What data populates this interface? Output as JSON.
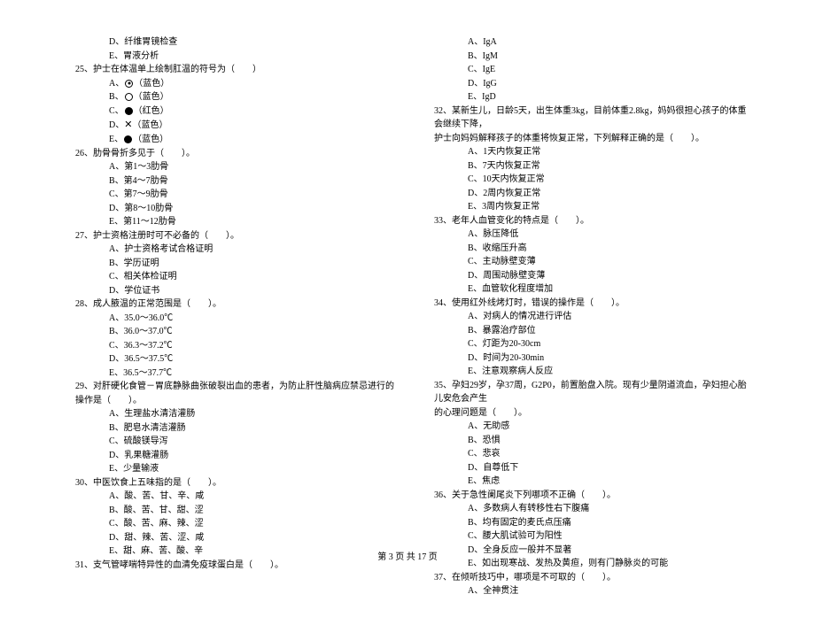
{
  "left_col": {
    "pre_options": [
      "D、纤维胃镜检查",
      "E、胃液分析"
    ],
    "q25": {
      "stem": "25、护士在体温单上绘制肛温的符号为（　　）",
      "a_prefix": "A、",
      "a_suffix": "（蓝色）",
      "b_prefix": "B、",
      "b_suffix": "（蓝色）",
      "c_prefix": "C、",
      "c_suffix": "（红色）",
      "d_prefix": "D、",
      "d_suffix": "（蓝色）",
      "e_prefix": "E、",
      "e_suffix": "（蓝色）"
    },
    "q26": {
      "stem": "26、肋骨骨折多见于（　　）。",
      "opts": [
        "A、第1～3肋骨",
        "B、第4～7肋骨",
        "C、第7～9肋骨",
        "D、第8～10肋骨",
        "E、第11～12肋骨"
      ]
    },
    "q27": {
      "stem": "27、护士资格注册时可不必备的（　　）。",
      "opts": [
        "A、护士资格考试合格证明",
        "B、学历证明",
        "C、相关体检证明",
        "D、学位证书"
      ]
    },
    "q28": {
      "stem": "28、成人腋温的正常范围是（　　）。",
      "opts": [
        "A、35.0～36.0℃",
        "B、36.0～37.0℃",
        "C、36.3～37.2℃",
        "D、36.5～37.5℃",
        "E、36.5～37.7℃"
      ]
    },
    "q29": {
      "stem": "29、对肝硬化食管－胃底静脉曲张破裂出血的患者，为防止肝性脑病应禁忌进行的操作是（　　）。",
      "opts": [
        "A、生理盐水清洁灌肠",
        "B、肥皂水清洁灌肠",
        "C、硫酸镁导泻",
        "D、乳果糖灌肠",
        "E、少量输液"
      ]
    },
    "q30": {
      "stem": "30、中医饮食上五味指的是（　　）。",
      "opts": [
        "A、酸、苦、甘、辛、咸",
        "B、酸、苦、甘、甜、涩",
        "C、酸、苦、麻、辣、涩",
        "D、甜、辣、苦、涩、咸",
        "E、甜、麻、苦、酸、辛"
      ]
    },
    "q31": {
      "stem": "31、支气管哮喘特异性的血清免疫球蛋白是（　　）。"
    }
  },
  "right_col": {
    "q31_opts": [
      "A、IgA",
      "B、IgM",
      "C、IgE",
      "D、IgG",
      "E、IgD"
    ],
    "q32": {
      "stem1": "32、某新生儿，日龄5天，出生体重3kg，目前体重2.8kg，妈妈很担心孩子的体重会继续下降，",
      "stem2": "护士向妈妈解释孩子的体重将恢复正常，下列解释正确的是（　　）。",
      "opts": [
        "A、1天内恢复正常",
        "B、7天内恢复正常",
        "C、10天内恢复正常",
        "D、2周内恢复正常",
        "E、3周内恢复正常"
      ]
    },
    "q33": {
      "stem": "33、老年人血管变化的特点是（　　）。",
      "opts": [
        "A、脉压降低",
        "B、收缩压升高",
        "C、主动脉壁变薄",
        "D、周围动脉壁变薄",
        "E、血管软化程度增加"
      ]
    },
    "q34": {
      "stem": "34、使用红外线烤灯时，错误的操作是（　　）。",
      "opts": [
        "A、对病人的情况进行评估",
        "B、暴露治疗部位",
        "C、灯距为20-30cm",
        "D、时间为20-30min",
        "E、注意观察病人反应"
      ]
    },
    "q35": {
      "stem1": "35、孕妇29岁，孕37周，G2P0，前置胎盘入院。现有少量阴道流血，孕妇担心胎儿安危会产生",
      "stem2": "的心理问题是（　　）。",
      "opts": [
        "A、无助感",
        "B、恐惧",
        "C、悲哀",
        "D、自尊低下",
        "E、焦虑"
      ]
    },
    "q36": {
      "stem": "36、关于急性阑尾炎下列哪项不正确（　　）。",
      "opts": [
        "A、多数病人有转移性右下腹痛",
        "B、均有固定的麦氏点压痛",
        "C、腰大肌试验可为阳性",
        "D、全身反应一般并不显著",
        "E、如出现寒战、发热及黄疸，则有门静脉炎的可能"
      ]
    },
    "q37": {
      "stem": "37、在倾听技巧中，哪项是不可取的（　　）。",
      "opts": [
        "A、全神贯注"
      ]
    }
  },
  "footer": "第 3 页 共 17 页"
}
